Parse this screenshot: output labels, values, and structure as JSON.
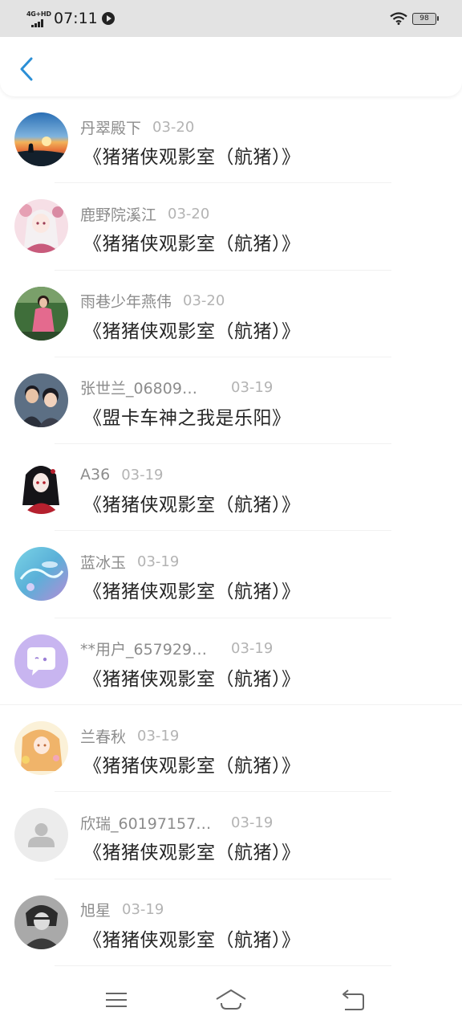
{
  "status_bar": {
    "network": "4G+HD",
    "time": "07:11",
    "battery": "98"
  },
  "header": {
    "back_icon": "chevron-left-icon",
    "accent": "#2b8fd6"
  },
  "items": [
    {
      "name": "丹翠殿下",
      "date": "03-20",
      "title": "《猪猪侠观影室（航猪）》"
    },
    {
      "name": "鹿野院溪江",
      "date": "03-20",
      "title": "《猪猪侠观影室（航猪）》"
    },
    {
      "name": "雨巷少年燕伟",
      "date": "03-20",
      "title": "《猪猪侠观影室（航猪）》"
    },
    {
      "name": "张世兰_06809…",
      "date": "03-19",
      "title": "《盟卡车神之我是乐阳》"
    },
    {
      "name": "A36",
      "date": "03-19",
      "title": "《猪猪侠观影室（航猪）》"
    },
    {
      "name": "蓝冰玉",
      "date": "03-19",
      "title": "《猪猪侠观影室（航猪）》"
    },
    {
      "name": "**用户_657929…",
      "date": "03-19",
      "title": "《猪猪侠观影室（航猪）》"
    },
    {
      "name": "兰春秋",
      "date": "03-19",
      "title": "《猪猪侠观影室（航猪）》"
    },
    {
      "name": "欣瑞_60197157…",
      "date": "03-19",
      "title": "《猪猪侠观影室（航猪）》"
    },
    {
      "name": "旭星",
      "date": "03-19",
      "title": "《猪猪侠观影室（航猪）》"
    }
  ],
  "nav_bar": {
    "menu_icon": "menu-icon",
    "home_icon": "home-icon",
    "back_icon": "back-arrow-icon"
  }
}
